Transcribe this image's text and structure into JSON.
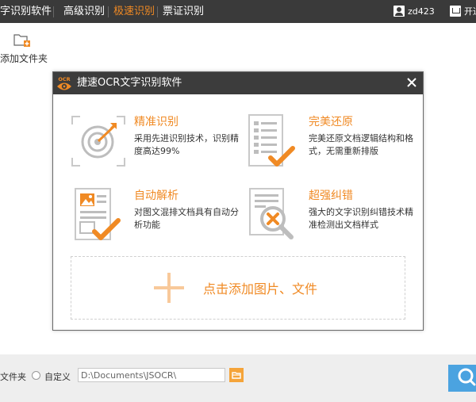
{
  "topbar": {
    "tabs": [
      {
        "label": "字识别软件"
      },
      {
        "label": "高级识别"
      },
      {
        "label": "极速识别"
      },
      {
        "label": "票证识别"
      }
    ],
    "username": "zd423",
    "vip_label": "开通"
  },
  "toolbar": {
    "add_folder_label": "添加文件夹"
  },
  "dialog": {
    "logo_text": "OCR",
    "title": "捷速OCR文字识别软件",
    "features": [
      {
        "title": "精准识别",
        "desc": "采用先进识别技术，识别精度高达99%",
        "icon": "target-icon"
      },
      {
        "title": "完美还原",
        "desc": "完美还原文档逻辑结构和格式，无需重新排版",
        "icon": "document-check-icon"
      },
      {
        "title": "自动解析",
        "desc": "对图文混排文档具有自动分析功能",
        "icon": "image-document-icon"
      },
      {
        "title": "超强纠错",
        "desc": "强大的文字识别纠错技术精准检测出文档样式",
        "icon": "error-magnifier-icon"
      }
    ],
    "drop_label": "点击添加图片、文件"
  },
  "bottombar": {
    "folder_option_label": "文件夹",
    "custom_option_label": "自定义",
    "path_value": "D:\\Documents\\JSOCR\\"
  },
  "colors": {
    "accent": "#f08a24",
    "topbar_bg": "#3a3a3a",
    "start_button": "#4ba3e0"
  }
}
